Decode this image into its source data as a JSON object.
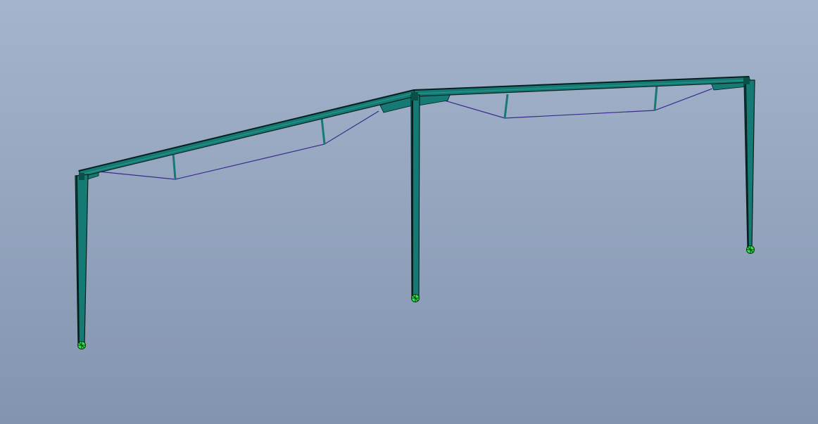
{
  "viewport": {
    "background_top": "#a4b4cc",
    "background_bottom": "#8394b0"
  },
  "model": {
    "member_color": "#167a74",
    "member_dark": "#0b4f4a",
    "member_edge": "#06201e",
    "brace_cable_color": "#3a2a8c",
    "support_color": "#2ee84a",
    "support_icon": "fixed-support-icon"
  }
}
